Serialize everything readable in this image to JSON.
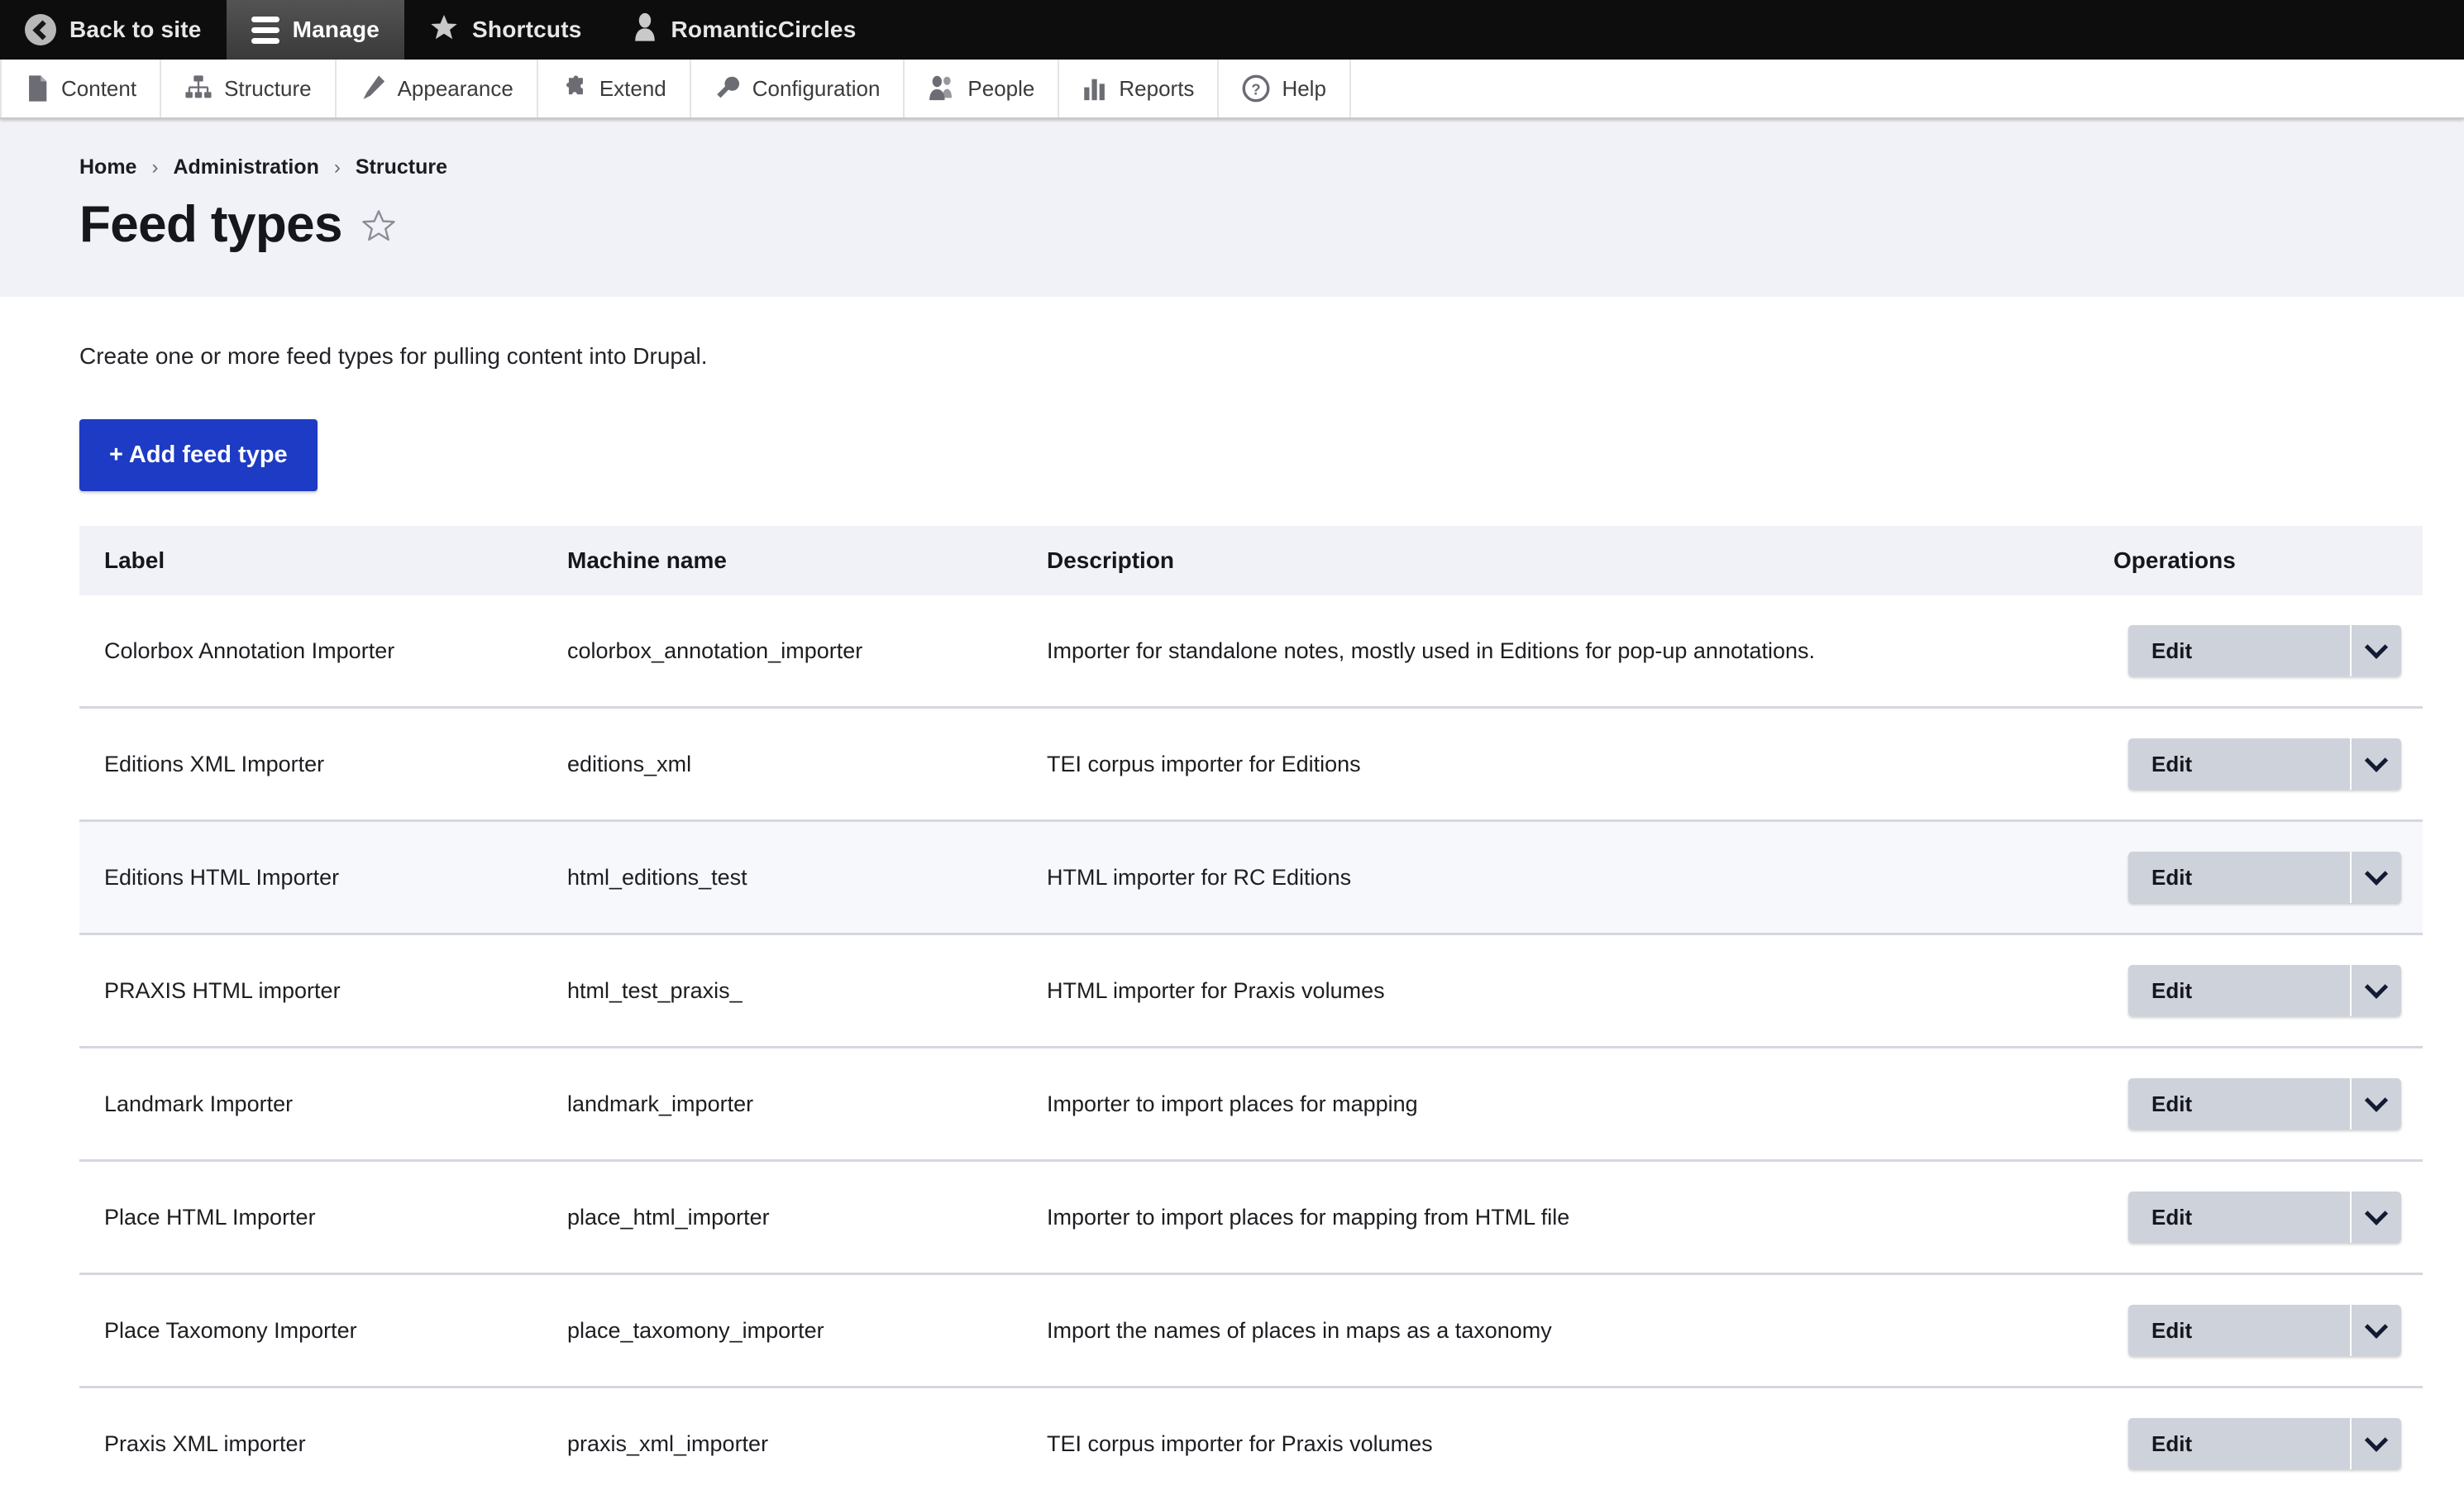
{
  "toolbar": {
    "items": [
      {
        "label": "Back to site",
        "icon": "back-arrow-icon",
        "active": false
      },
      {
        "label": "Manage",
        "icon": "hamburger-icon",
        "active": true
      },
      {
        "label": "Shortcuts",
        "icon": "star-icon",
        "active": false
      },
      {
        "label": "RomanticCircles",
        "icon": "user-icon",
        "active": false
      }
    ]
  },
  "admin_menu": {
    "items": [
      {
        "label": "Content",
        "icon": "content-page-icon"
      },
      {
        "label": "Structure",
        "icon": "structure-tree-icon"
      },
      {
        "label": "Appearance",
        "icon": "appearance-brush-icon"
      },
      {
        "label": "Extend",
        "icon": "extend-puzzle-icon"
      },
      {
        "label": "Configuration",
        "icon": "configuration-wrench-icon"
      },
      {
        "label": "People",
        "icon": "people-icon"
      },
      {
        "label": "Reports",
        "icon": "reports-bars-icon"
      },
      {
        "label": "Help",
        "icon": "help-question-icon"
      }
    ]
  },
  "breadcrumb": {
    "items": [
      "Home",
      "Administration",
      "Structure"
    ],
    "separator": "›"
  },
  "header": {
    "title": "Feed types",
    "bookmark_icon": "star-outline-icon"
  },
  "main": {
    "intro": "Create one or more feed types for pulling content into Drupal.",
    "add_button": "+ Add feed type"
  },
  "table": {
    "columns": [
      "Label",
      "Machine name",
      "Description",
      "Operations"
    ],
    "operation_label": "Edit",
    "operation_toggle_icon": "chevron-down-icon",
    "rows": [
      {
        "label": "Colorbox Annotation Importer",
        "machine_name": "colorbox_annotation_importer",
        "description": "Importer for standalone notes, mostly used in Editions for pop-up annotations.",
        "striped": false
      },
      {
        "label": "Editions XML Importer",
        "machine_name": "editions_xml",
        "description": "TEI corpus importer for Editions",
        "striped": false
      },
      {
        "label": "Editions HTML Importer",
        "machine_name": "html_editions_test",
        "description": "HTML importer for RC Editions",
        "striped": true
      },
      {
        "label": "PRAXIS HTML importer",
        "machine_name": "html_test_praxis_",
        "description": "HTML importer for Praxis volumes",
        "striped": false
      },
      {
        "label": "Landmark Importer",
        "machine_name": "landmark_importer",
        "description": "Importer to import places for mapping",
        "striped": false
      },
      {
        "label": "Place HTML Importer",
        "machine_name": "place_html_importer",
        "description": "Importer to import places for mapping from HTML file",
        "striped": false
      },
      {
        "label": "Place Taxomony Importer",
        "machine_name": "place_taxomony_importer",
        "description": "Import the names of places in maps as a taxonomy",
        "striped": false
      },
      {
        "label": "Praxis XML importer",
        "machine_name": "praxis_xml_importer",
        "description": "TEI corpus importer for Praxis volumes",
        "striped": false
      }
    ]
  },
  "colors": {
    "toolbar_bg": "#0d0d0d",
    "toolbar_active": "#4a4a4a",
    "header_band": "#f1f2f7",
    "primary_button": "#1d3bc4",
    "operation_button": "#ced2da",
    "row_stripe": "#f7f8fc",
    "text": "#16161d"
  }
}
